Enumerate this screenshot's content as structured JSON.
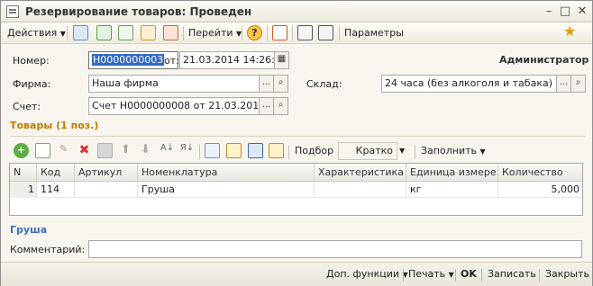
{
  "window": {
    "title": "Резервирование товаров: Проведен",
    "minimize": "–",
    "maximize": "□",
    "close": "✕"
  },
  "toolbar": {
    "actions": "Действия",
    "goto": "Перейти",
    "help": "?",
    "parameters": "Параметры"
  },
  "header": {
    "number_label": "Номер:",
    "number_value": "Н0000000003",
    "date_label": "от:",
    "date_value": "21.03.2014 14:26:15",
    "user": "Администратор",
    "firm_label": "Фирма:",
    "firm_value": "Наша фирма",
    "warehouse_label": "Склад:",
    "warehouse_value": "24 часа (без алкоголя и табака)",
    "invoice_label": "Счет:",
    "invoice_value": "Счет Н0000000008 от 21.03.2014 14:..."
  },
  "goods": {
    "section_title": "Товары (1 поз.)",
    "pick_label": "Подбор",
    "mode_value": "Кратко",
    "fill_label": "Заполнить",
    "columns": [
      "N",
      "Код",
      "Артикул",
      "Номенклатура",
      "Характеристика",
      "Единица измере...",
      "Количество"
    ],
    "rows": [
      {
        "n": "1",
        "code": "114",
        "article": "",
        "name": "Груша",
        "characteristic": "",
        "unit": "кг",
        "quantity": "5,000"
      }
    ]
  },
  "details": {
    "selected_name": "Груша",
    "comment_label": "Комментарий:",
    "comment_value": ""
  },
  "footer": {
    "extra_functions": "Доп. функции",
    "print": "Печать",
    "ok": "OK",
    "save": "Записать",
    "close": "Закрыть"
  }
}
